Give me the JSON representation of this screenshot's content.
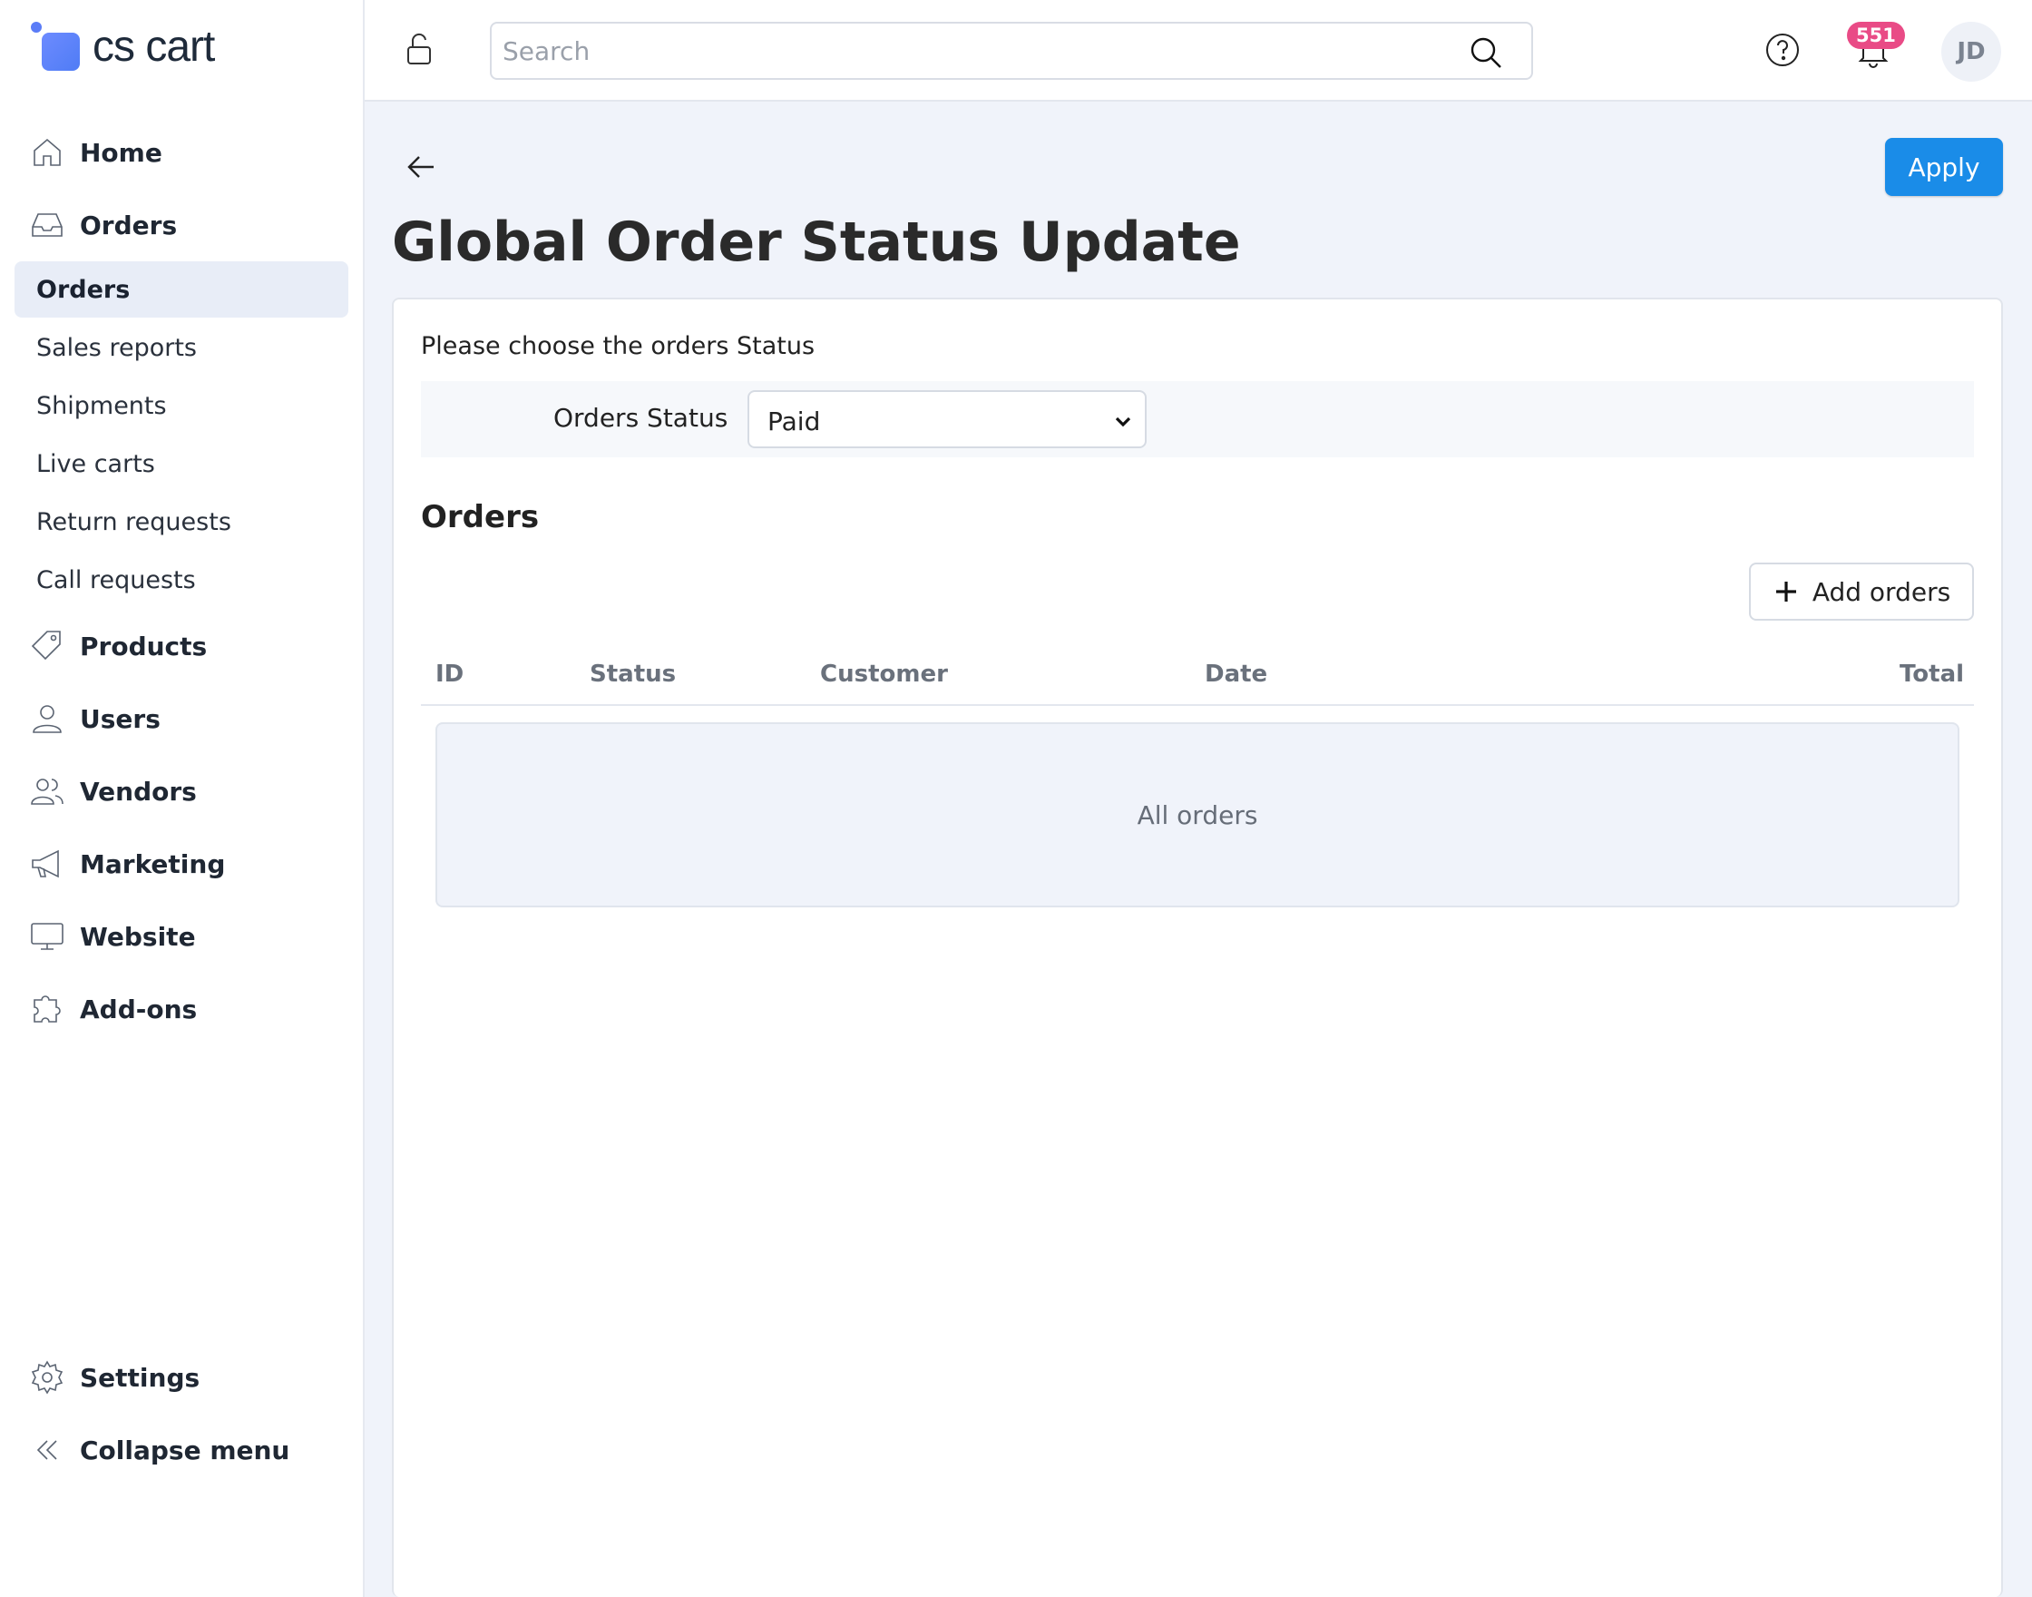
{
  "brand": {
    "logo_text": "cs cart"
  },
  "sidebar": {
    "items": [
      {
        "label": "Home",
        "icon": "home-icon"
      },
      {
        "label": "Orders",
        "icon": "inbox-icon"
      },
      {
        "label": "Products",
        "icon": "tag-icon"
      },
      {
        "label": "Users",
        "icon": "user-icon"
      },
      {
        "label": "Vendors",
        "icon": "users-icon"
      },
      {
        "label": "Marketing",
        "icon": "megaphone-icon"
      },
      {
        "label": "Website",
        "icon": "monitor-icon"
      },
      {
        "label": "Add-ons",
        "icon": "puzzle-icon"
      }
    ],
    "orders_submenu": [
      {
        "label": "Orders",
        "active": true
      },
      {
        "label": "Sales reports"
      },
      {
        "label": "Shipments"
      },
      {
        "label": "Live carts"
      },
      {
        "label": "Return requests"
      },
      {
        "label": "Call requests"
      }
    ],
    "bottom": [
      {
        "label": "Settings",
        "icon": "gear-icon"
      },
      {
        "label": "Collapse menu",
        "icon": "double-chevron-left-icon"
      }
    ]
  },
  "topbar": {
    "search_placeholder": "Search",
    "notification_count": "551",
    "avatar_initials": "JD"
  },
  "page": {
    "title": "Global Order Status Update",
    "apply_label": "Apply",
    "hint": "Please choose the orders Status",
    "status_label": "Orders Status",
    "status_value": "Paid",
    "orders_heading": "Orders",
    "add_orders_label": "Add orders",
    "columns": [
      "ID",
      "Status",
      "Customer",
      "Date",
      "Total"
    ],
    "empty_text": "All orders"
  },
  "colors": {
    "accent": "#1a8ce8",
    "badge": "#e94b86",
    "background": "#f0f3fa"
  }
}
